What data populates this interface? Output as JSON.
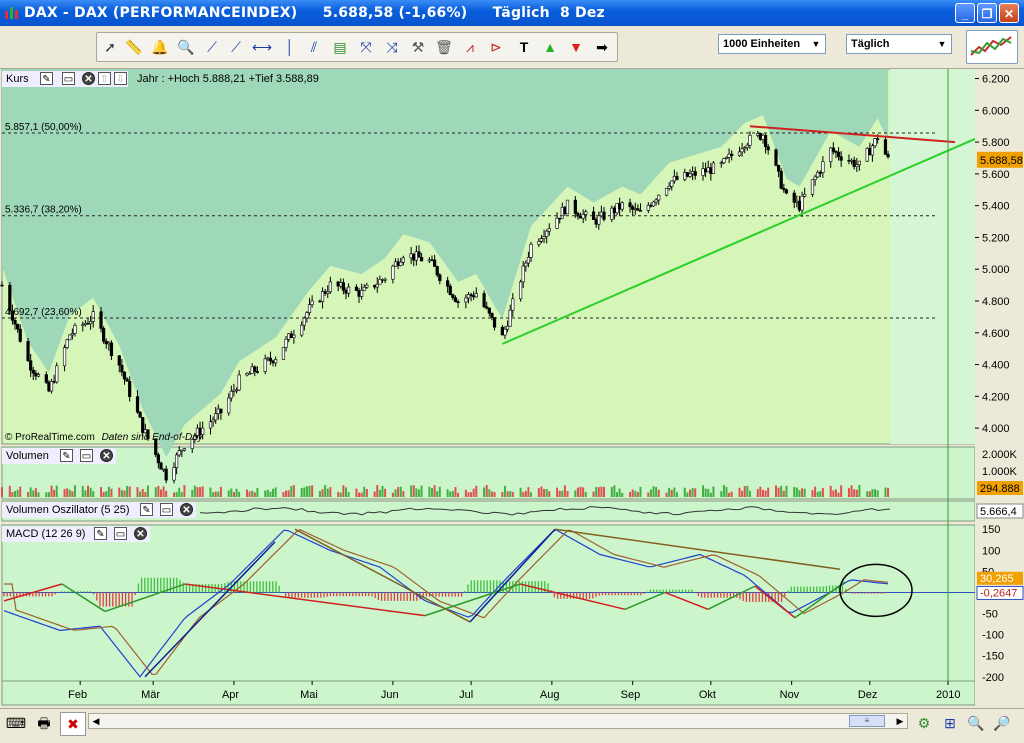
{
  "window": {
    "title": "DAX - DAX (PERFORMANCEINDEX)     5.688,58 (-1,66%)     Täglich  8 Dez"
  },
  "toolbar": {
    "units_select": "1000 Einheiten",
    "period_select": "Täglich",
    "tools": [
      "cursor-tool",
      "ruler-tool",
      "alarm-tool",
      "zoom-tool",
      "line-tool",
      "trend-line-tool",
      "horizontal-line-tool",
      "vertical-line-tool",
      "channel-tool",
      "fibonacci-tool",
      "fan-tool",
      "parallel-tool",
      "tools-settings",
      "delete-tool",
      "pattern-tool",
      "triangle-tool",
      "text-tool",
      "buy-arrow-tool",
      "sell-arrow-tool",
      "forward-tool"
    ]
  },
  "panes": {
    "price": {
      "name": "Kurs",
      "info": "Jahr : +Hoch 5.888,21 +Tief 3.588,89",
      "credit": "© ProRealTime.com",
      "credit2": "Daten sind End-of-Day",
      "last_price_label": "5.688,58"
    },
    "volume": {
      "name": "Volumen",
      "last_label": "294.888"
    },
    "vol_osc": {
      "name": "Volumen Oszillator (5 25)",
      "last_label": "5.666,4"
    },
    "macd": {
      "name": "MACD (12 26 9)",
      "label_macd": "30,265",
      "label_hist": "-0,2647"
    }
  },
  "chart_data": [
    {
      "type": "candlestick",
      "title": "DAX (PERFORMANCEINDEX) Täglich",
      "x_axis": [
        "Feb",
        "Mär",
        "Apr",
        "Mai",
        "Jun",
        "Jul",
        "Aug",
        "Sep",
        "Okt",
        "Nov",
        "Dez",
        "2010"
      ],
      "y_axis_ticks": [
        4000,
        4200,
        4400,
        4600,
        4800,
        5000,
        5200,
        5400,
        5600,
        5800,
        6000,
        6200
      ],
      "ylim": [
        3900,
        6260
      ],
      "fibonacci_levels": [
        {
          "label": "5.857,1 (50,00%)",
          "value": 5857.1
        },
        {
          "label": "5.336,7 (38,20%)",
          "value": 5336.7
        },
        {
          "label": "4.692,7 (23,60%)",
          "value": 4692.7
        }
      ],
      "year_high": 5888.21,
      "year_low": 3588.89,
      "last": 5688.58,
      "change_pct": -1.66,
      "close_series_approx": [
        {
          "x": "2009-01-02",
          "y": 4900
        },
        {
          "x": "2009-01-12",
          "y": 4420
        },
        {
          "x": "2009-01-20",
          "y": 4230
        },
        {
          "x": "2009-01-28",
          "y": 4590
        },
        {
          "x": "2009-02-06",
          "y": 4700
        },
        {
          "x": "2009-02-16",
          "y": 4400
        },
        {
          "x": "2009-02-25",
          "y": 4000
        },
        {
          "x": "2009-03-06",
          "y": 3700
        },
        {
          "x": "2009-03-13",
          "y": 3900
        },
        {
          "x": "2009-03-20",
          "y": 4000
        },
        {
          "x": "2009-03-27",
          "y": 4100
        },
        {
          "x": "2009-04-03",
          "y": 4300
        },
        {
          "x": "2009-04-17",
          "y": 4450
        },
        {
          "x": "2009-04-30",
          "y": 4750
        },
        {
          "x": "2009-05-08",
          "y": 4900
        },
        {
          "x": "2009-05-20",
          "y": 4850
        },
        {
          "x": "2009-05-29",
          "y": 4950
        },
        {
          "x": "2009-06-05",
          "y": 5100
        },
        {
          "x": "2009-06-15",
          "y": 5050
        },
        {
          "x": "2009-06-26",
          "y": 4800
        },
        {
          "x": "2009-07-03",
          "y": 4850
        },
        {
          "x": "2009-07-10",
          "y": 4650
        },
        {
          "x": "2009-07-13",
          "y": 4570
        },
        {
          "x": "2009-07-24",
          "y": 5150
        },
        {
          "x": "2009-08-07",
          "y": 5400
        },
        {
          "x": "2009-08-17",
          "y": 5300
        },
        {
          "x": "2009-08-28",
          "y": 5400
        },
        {
          "x": "2009-09-04",
          "y": 5350
        },
        {
          "x": "2009-09-15",
          "y": 5550
        },
        {
          "x": "2009-09-25",
          "y": 5600
        },
        {
          "x": "2009-10-05",
          "y": 5650
        },
        {
          "x": "2009-10-14",
          "y": 5800
        },
        {
          "x": "2009-10-21",
          "y": 5850
        },
        {
          "x": "2009-10-30",
          "y": 5450
        },
        {
          "x": "2009-11-04",
          "y": 5400
        },
        {
          "x": "2009-11-16",
          "y": 5750
        },
        {
          "x": "2009-11-27",
          "y": 5650
        },
        {
          "x": "2009-12-04",
          "y": 5830
        },
        {
          "x": "2009-12-08",
          "y": 5688
        }
      ]
    },
    {
      "type": "bar",
      "title": "Volumen",
      "y_axis_ticks": [
        "2.000K",
        "1.000K"
      ],
      "last": "294.888"
    },
    {
      "type": "line",
      "title": "Volumen Oszillator (5 25)",
      "last": 5666.4
    },
    {
      "type": "line",
      "title": "MACD (12 26 9)",
      "y_axis_ticks": [
        150,
        100,
        50,
        0,
        -50,
        -100,
        -150,
        -200
      ],
      "ylim": [
        -210,
        160
      ],
      "last_macd": 30.265,
      "last_histogram": -0.2647
    }
  ],
  "statusbar": {
    "buttons": [
      "keyboard-button",
      "print-button",
      "delete-button",
      "scroll-left",
      "scroll-right",
      "properties-button",
      "zoom-fit-button",
      "zoom-out-button",
      "zoom-in-button"
    ]
  }
}
